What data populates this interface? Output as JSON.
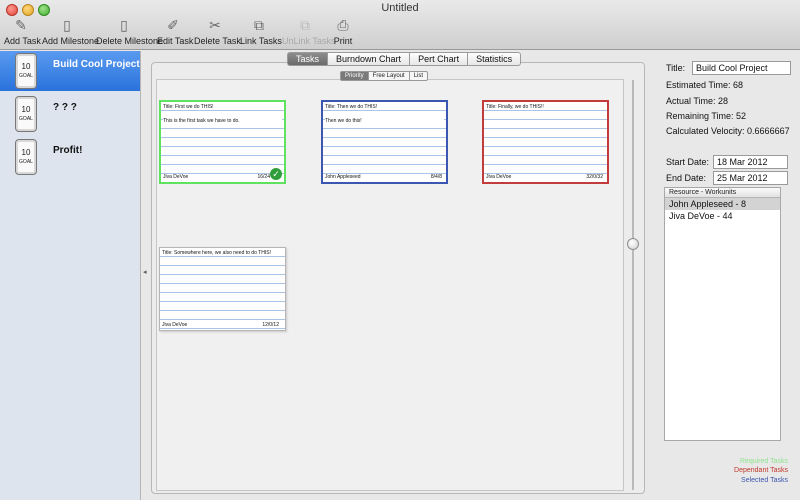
{
  "window": {
    "title": "Untitled"
  },
  "toolbar": [
    {
      "label": "Add Task",
      "icon": "add-task-icon",
      "enabled": true
    },
    {
      "label": "Add Milestone",
      "icon": "add-milestone-icon",
      "enabled": true
    },
    {
      "label": "Delete Milestone",
      "icon": "delete-milestone-icon",
      "enabled": true
    },
    {
      "label": "Edit Task",
      "icon": "edit-task-icon",
      "enabled": true
    },
    {
      "label": "Delete Task",
      "icon": "delete-task-icon",
      "enabled": true
    },
    {
      "label": "Link Tasks",
      "icon": "link-tasks-icon",
      "enabled": true
    },
    {
      "label": "UnLink Tasks",
      "icon": "unlink-tasks-icon",
      "enabled": false
    },
    {
      "label": "Print",
      "icon": "print-icon",
      "enabled": true
    }
  ],
  "sidebar": {
    "milestones": [
      {
        "label": "Build Cool Project",
        "badge_number": "10",
        "badge_text": "GOAL",
        "selected": true
      },
      {
        "label": "? ? ?",
        "badge_number": "10",
        "badge_text": "GOAL",
        "selected": false
      },
      {
        "label": "Profit!",
        "badge_number": "10",
        "badge_text": "GOAL",
        "selected": false
      }
    ]
  },
  "tabs": [
    {
      "label": "Tasks",
      "active": true
    },
    {
      "label": "Burndown Chart",
      "active": false
    },
    {
      "label": "Pert Chart",
      "active": false
    },
    {
      "label": "Statistics",
      "active": false
    }
  ],
  "subtabs": [
    {
      "label": "Priority",
      "active": true
    },
    {
      "label": "Free Layout",
      "active": false
    },
    {
      "label": "List",
      "active": false
    }
  ],
  "cards": [
    {
      "title": "Title: First we do THIS!",
      "description": "This is the first task we have to do.",
      "owner": "Jiva DeVoe",
      "units": "16/24",
      "style": "green",
      "completed": true
    },
    {
      "title": "Title: Then we do THIS!",
      "description": "Then we do this!",
      "owner": "John Appleseed",
      "units": "8/4/8",
      "style": "blue",
      "completed": false
    },
    {
      "title": "Title: Finally, we do THIS!!",
      "description": "",
      "owner": "Jiva DeVoe",
      "units": "32/0/32",
      "style": "red",
      "completed": false
    },
    {
      "title": "Title: Somewhere here, we also need to do THIS!",
      "description": "",
      "owner": "Jiva DeVoe",
      "units": "12/0/12",
      "style": "gray",
      "completed": false
    }
  ],
  "details": {
    "title_label": "Title:",
    "title_value": "Build Cool Project",
    "estimated": "Estimated Time: 68",
    "actual": "Actual Time: 28",
    "remaining": "Remaining Time: 52",
    "velocity": "Calculated Velocity: 0.6666667",
    "start_label": "Start Date:",
    "start_value": "18 Mar 2012",
    "end_label": "End Date:",
    "end_value": "25 Mar 2012"
  },
  "resources": {
    "header": "Resource - Workunits",
    "rows": [
      {
        "label": "John Appleseed - 8",
        "selected": true
      },
      {
        "label": "Jiva DeVoe - 44",
        "selected": false
      }
    ]
  },
  "legend": [
    {
      "label": "Required Tasks",
      "color": "#8ee38e"
    },
    {
      "label": "Dependant Tasks",
      "color": "#c0392b"
    },
    {
      "label": "Selected Tasks",
      "color": "#3c57b0"
    }
  ]
}
